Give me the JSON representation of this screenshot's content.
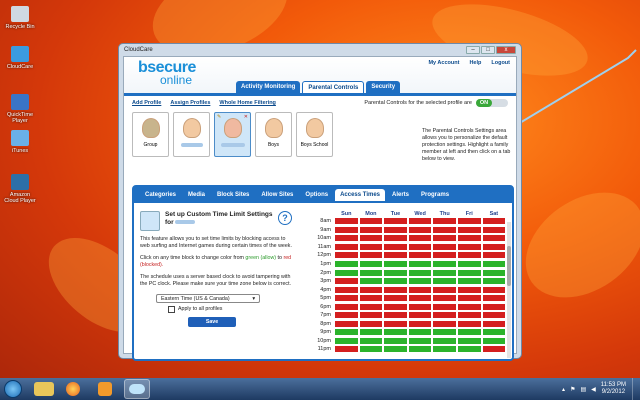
{
  "desktop": {
    "icons": [
      {
        "label": "Recycle Bin",
        "name": "recycle-bin-icon",
        "color": "#cfd8e2"
      },
      {
        "label": "CloudCare",
        "name": "cloudcare-icon",
        "color": "#3b9be0"
      },
      {
        "label": "QuickTime Player",
        "name": "quicktime-icon",
        "color": "#3a74c7"
      },
      {
        "label": "iTunes",
        "name": "itunes-icon",
        "color": "#6ab0e8"
      },
      {
        "label": "Amazon Cloud Player",
        "name": "amazon-cloud-player-icon",
        "color": "#2d6fa8"
      }
    ]
  },
  "window": {
    "title": "CloudCare",
    "min": "–",
    "max": "□",
    "close": "x"
  },
  "header": {
    "logo_b": "bsecure",
    "logo_o": "online",
    "links": [
      "My Account",
      "Help",
      "Logout"
    ],
    "tabs": [
      "Activity Monitoring",
      "Parental Controls",
      "Security"
    ],
    "active_tab": 1
  },
  "profilebar": {
    "add": "Add Profile",
    "assign": "Assign Profiles",
    "whole": "Whole Home Filtering",
    "pc_label": "Parental Controls for the selected profile are",
    "toggle": "ON"
  },
  "profiles": [
    {
      "label": "Group"
    },
    {
      "label": ""
    },
    {
      "label": ""
    },
    {
      "label": "Boys"
    },
    {
      "label": "Boys School"
    }
  ],
  "help": "The Parental Controls Settings area allows you to personalize the default protection settings. Highlight a family member at left and then click on a tab below to view.",
  "subtabs": [
    "Categories",
    "Media",
    "Block Sites",
    "Allow Sites",
    "Options",
    "Access Times",
    "Alerts",
    "Programs"
  ],
  "active_subtab": 5,
  "left": {
    "title": "Set up Custom Time Limit Settings for",
    "help_q": "?",
    "p1": "This feature allows you to set time limits by blocking access to web surfing and Internet games during certain times of the week.",
    "p2a": "Click on any time block to change color from",
    "p2_green": "green (allow)",
    "p2_to": "to",
    "p2_red": "red (blocked).",
    "p3": "The schedule uses a server based clock to avoid tampering with the PC clock. Please make sure your time zone below is correct.",
    "timezone": "Eastern Time (US & Canada)",
    "tz_arrow": "▾",
    "apply": "Apply to all profiles",
    "save": "Save"
  },
  "schedule": {
    "days": [
      "Sun",
      "Mon",
      "Tue",
      "Wed",
      "Thu",
      "Fri",
      "Sat"
    ],
    "hours": [
      "8am",
      "9am",
      "10am",
      "11am",
      "12pm",
      "1pm",
      "2pm",
      "3pm",
      "4pm",
      "5pm",
      "6pm",
      "7pm",
      "8pm",
      "9pm",
      "10pm",
      "11pm"
    ],
    "grid": [
      "RRRRRRR",
      "RRRRRRR",
      "RRRRRRR",
      "RRRRRRR",
      "RRRRRRR",
      "GGGGGGG",
      "GGGGGGG",
      "RGGGGGG",
      "RRRRRRR",
      "RRRRRRR",
      "RRRRRRR",
      "RRRRRRR",
      "RRRRRRR",
      "GGGGGGG",
      "GGGGGGG",
      "RGGGGGR"
    ]
  },
  "taskbar": {
    "time": "11:53 PM",
    "date": "9/2/2012"
  }
}
